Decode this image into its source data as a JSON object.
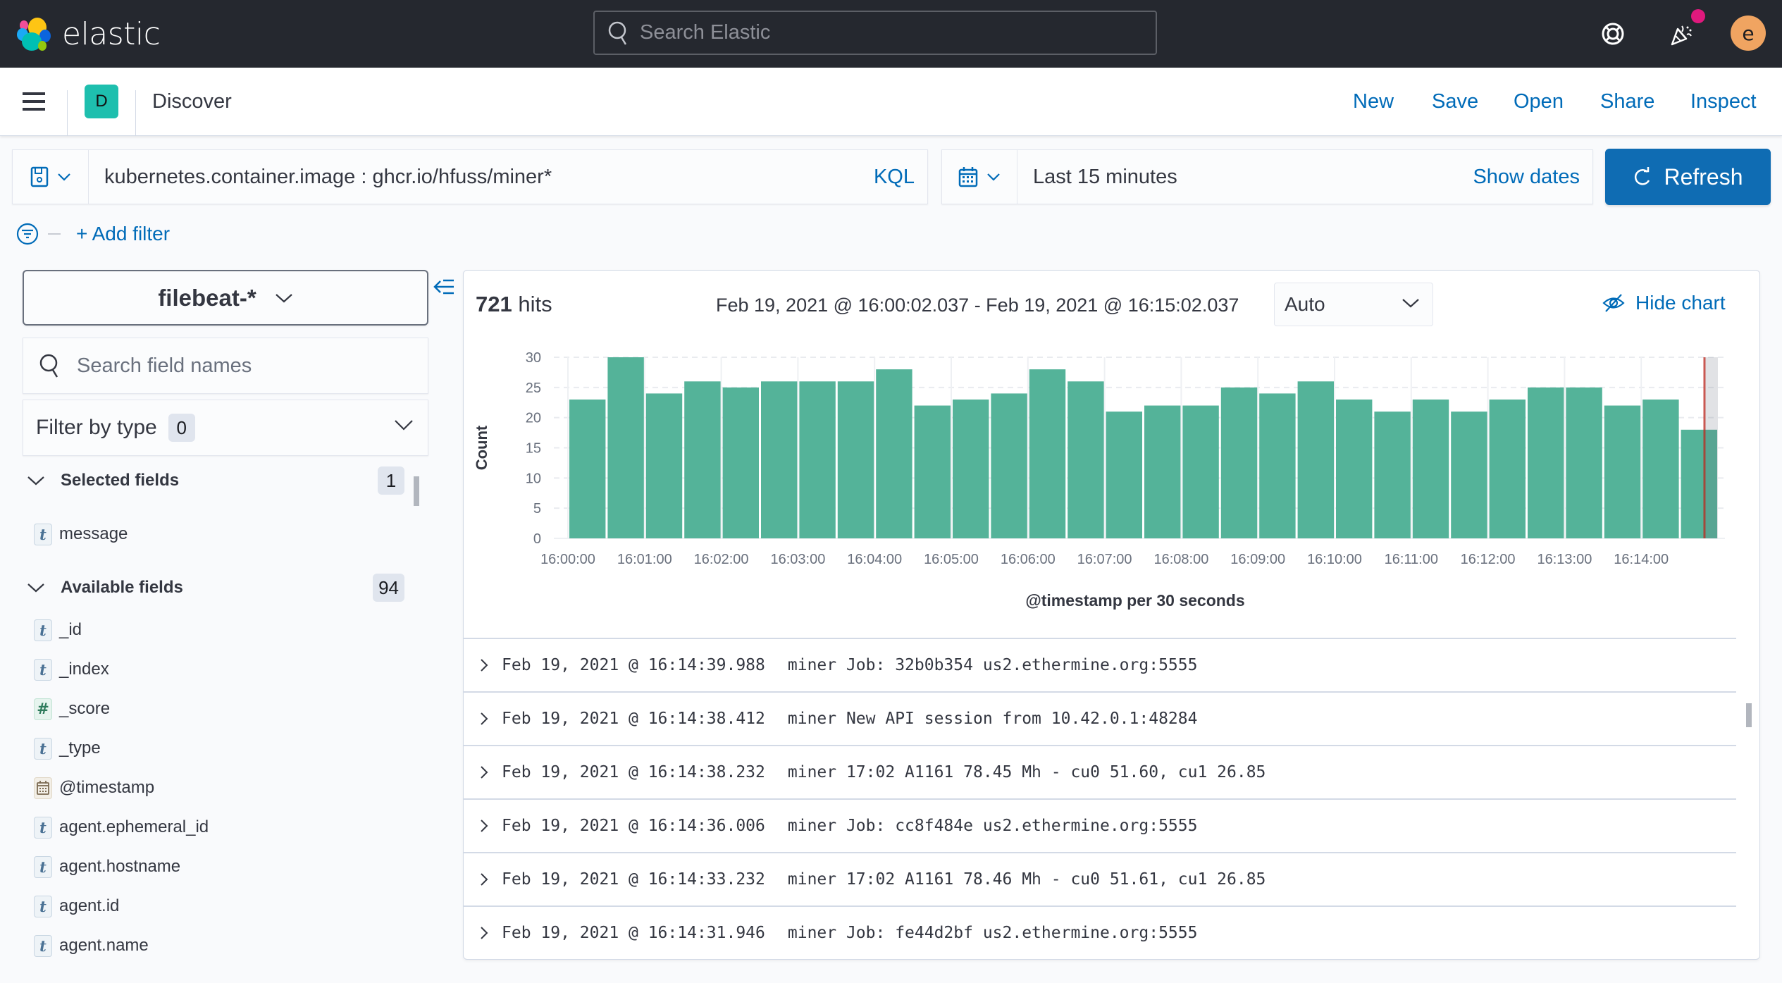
{
  "header": {
    "brand": "elastic",
    "search_placeholder": "Search Elastic",
    "icons": [
      "help-lifebuoy-icon",
      "newsfeed-party-icon"
    ],
    "notification_dot_color": "#e0197d",
    "user_initial": "e",
    "avatar_color": "#f0a461"
  },
  "appbar": {
    "space_initial": "D",
    "space_color": "#1ebfae",
    "title": "Discover",
    "menu": [
      "New",
      "Save",
      "Open",
      "Share",
      "Inspect"
    ]
  },
  "query": {
    "value": "kubernetes.container.image : ghcr.io/hfuss/miner*",
    "language": "KQL"
  },
  "time": {
    "label": "Last 15 minutes",
    "show_dates": "Show dates",
    "refresh": "Refresh"
  },
  "filters": {
    "add_label": "+ Add filter"
  },
  "sidebar": {
    "index_pattern": "filebeat-*",
    "search_placeholder": "Search field names",
    "filter_by_type": "Filter by type",
    "filter_count": "0",
    "selected": {
      "title": "Selected fields",
      "count": "1",
      "fields": [
        {
          "type": "t",
          "name": "message"
        }
      ]
    },
    "available": {
      "title": "Available fields",
      "count": "94",
      "fields": [
        {
          "type": "t",
          "name": "_id"
        },
        {
          "type": "t",
          "name": "_index"
        },
        {
          "type": "#",
          "name": "_score"
        },
        {
          "type": "t",
          "name": "_type"
        },
        {
          "type": "date",
          "name": "@timestamp"
        },
        {
          "type": "t",
          "name": "agent.ephemeral_id"
        },
        {
          "type": "t",
          "name": "agent.hostname"
        },
        {
          "type": "t",
          "name": "agent.id"
        },
        {
          "type": "t",
          "name": "agent.name"
        }
      ]
    }
  },
  "main": {
    "hits_count": "721",
    "hits_label": "hits",
    "range": "Feb 19, 2021 @ 16:00:02.037 - Feb 19, 2021 @ 16:15:02.037",
    "interval": "Auto",
    "hide_chart": "Hide chart",
    "bar_color": "#54b399",
    "now_marker_color": "#bd271e",
    "documents": [
      {
        "timestamp": "Feb 19, 2021 @ 16:14:39.988",
        "message": "miner Job: 32b0b354 us2.ethermine.org:5555"
      },
      {
        "timestamp": "Feb 19, 2021 @ 16:14:38.412",
        "message": "miner New API session from 10.42.0.1:48284"
      },
      {
        "timestamp": "Feb 19, 2021 @ 16:14:38.232",
        "message": "miner 17:02 A1161 78.45 Mh - cu0 51.60, cu1 26.85"
      },
      {
        "timestamp": "Feb 19, 2021 @ 16:14:36.006",
        "message": "miner Job: cc8f484e us2.ethermine.org:5555"
      },
      {
        "timestamp": "Feb 19, 2021 @ 16:14:33.232",
        "message": "miner 17:02 A1161 78.46 Mh - cu0 51.61, cu1 26.85"
      },
      {
        "timestamp": "Feb 19, 2021 @ 16:14:31.946",
        "message": "miner Job: fe44d2bf us2.ethermine.org:5555"
      }
    ]
  },
  "chart_data": {
    "type": "bar",
    "title": "",
    "xlabel": "@timestamp per 30 seconds",
    "ylabel": "Count",
    "ylim": [
      0,
      30
    ],
    "yticks": [
      0,
      5,
      10,
      15,
      20,
      25,
      30
    ],
    "xticks": [
      "16:00:00",
      "16:01:00",
      "16:02:00",
      "16:03:00",
      "16:04:00",
      "16:05:00",
      "16:06:00",
      "16:07:00",
      "16:08:00",
      "16:09:00",
      "16:10:00",
      "16:11:00",
      "16:12:00",
      "16:13:00",
      "16:14:00"
    ],
    "categories": [
      "16:00:00",
      "16:00:30",
      "16:01:00",
      "16:01:30",
      "16:02:00",
      "16:02:30",
      "16:03:00",
      "16:03:30",
      "16:04:00",
      "16:04:30",
      "16:05:00",
      "16:05:30",
      "16:06:00",
      "16:06:30",
      "16:07:00",
      "16:07:30",
      "16:08:00",
      "16:08:30",
      "16:09:00",
      "16:09:30",
      "16:10:00",
      "16:10:30",
      "16:11:00",
      "16:11:30",
      "16:12:00",
      "16:12:30",
      "16:13:00",
      "16:13:30",
      "16:14:00",
      "16:14:30"
    ],
    "values": [
      23,
      30,
      24,
      26,
      25,
      26,
      26,
      26,
      28,
      22,
      23,
      24,
      28,
      26,
      21,
      22,
      22,
      25,
      24,
      26,
      23,
      21,
      23,
      21,
      23,
      25,
      25,
      22,
      23,
      18
    ],
    "grid": true,
    "legend": "none"
  }
}
